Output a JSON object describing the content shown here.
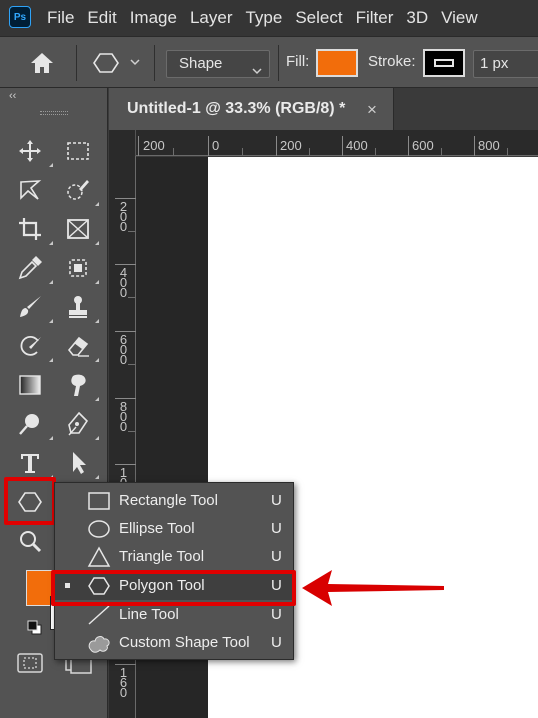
{
  "app": {
    "logo": "Ps"
  },
  "menubar": {
    "items": [
      "File",
      "Edit",
      "Image",
      "Layer",
      "Type",
      "Select",
      "Filter",
      "3D",
      "View"
    ]
  },
  "options_bar": {
    "home_icon": "home-icon",
    "tool_preset_icon": "polygon-icon",
    "mode_select": "Shape",
    "fill_label": "Fill:",
    "fill_color": "#f26d0b",
    "stroke_label": "Stroke:",
    "stroke_color": "#000000",
    "stroke_width": "1 px"
  },
  "document": {
    "tab_title": "Untitled-1 @ 33.3% (RGB/8) *",
    "close_glyph": "×",
    "horizontal_ruler": [
      "200",
      "0",
      "200",
      "400",
      "600",
      "800"
    ],
    "vertical_ruler": [
      "2\n0\n0",
      "4\n0\n0",
      "6\n0\n0",
      "8\n0\n0",
      "1\n0",
      "1\n6\n0"
    ]
  },
  "toolbar": {
    "collapse_glyph": "‹‹",
    "tools": [
      "move-icon",
      "marquee-icon",
      "lasso-icon",
      "quick-select-icon",
      "crop-icon",
      "frame-icon",
      "eyedropper-icon",
      "patch-heal-icon",
      "brush-icon",
      "stamp-icon",
      "history-brush-icon",
      "eraser-icon",
      "gradient-icon",
      "smudge-icon",
      "dodge-icon",
      "pen-icon",
      "type-icon",
      "path-select-icon",
      "polygon-shape-icon",
      "zoom-icon"
    ],
    "foreground_color": "#f26d0b",
    "background_color": "#ffffff"
  },
  "shape_flyout": {
    "items": [
      {
        "label": "Rectangle Tool",
        "key": "U",
        "icon": "rectangle-icon"
      },
      {
        "label": "Ellipse Tool",
        "key": "U",
        "icon": "ellipse-icon"
      },
      {
        "label": "Triangle Tool",
        "key": "U",
        "icon": "triangle-icon"
      },
      {
        "label": "Polygon Tool",
        "key": "U",
        "icon": "polygon-icon",
        "selected": true
      },
      {
        "label": "Line Tool",
        "key": "U",
        "icon": "line-icon"
      },
      {
        "label": "Custom Shape Tool",
        "key": "U",
        "icon": "custom-shape-icon"
      }
    ]
  },
  "annotation": {
    "highlight_color": "#e00000"
  }
}
